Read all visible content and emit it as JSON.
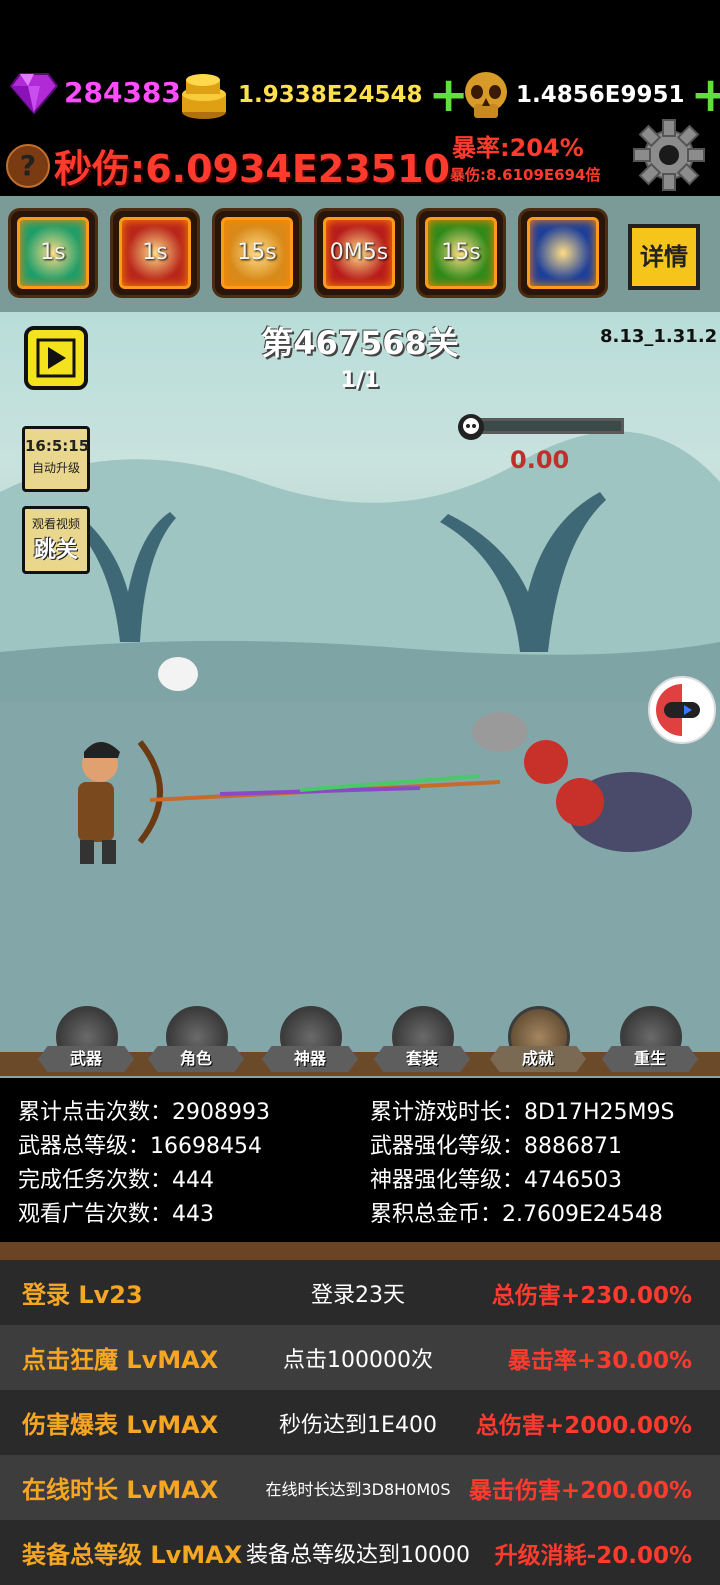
{
  "resources": {
    "gems": "284383",
    "gold": "1.9338E24548",
    "souls": "1.4856E9951",
    "gem_icon": "purple-diamond-icon",
    "gold_icon": "gold-coins-icon",
    "soul_icon": "golden-skull-icon"
  },
  "combat": {
    "dps": "秒伤:6.0934E23510",
    "crit_rate": "暴率:204%",
    "crit_damage": "暴伤:8.6109E694倍"
  },
  "skills": [
    {
      "label": "1s",
      "color": "#1f9e6a"
    },
    {
      "label": "1s",
      "color": "#b8261b"
    },
    {
      "label": "15s",
      "color": "#d88a1a"
    },
    {
      "label": "0M5s",
      "color": "#b71c1c"
    },
    {
      "label": "15s",
      "color": "#2f8a1a"
    },
    {
      "label": "",
      "color": "#1c3f9a"
    }
  ],
  "detail_button": "详情",
  "stage": {
    "title": "第467568关",
    "wave": "1/1",
    "version": "8.13_1.31.2",
    "boss_hp": "0.00"
  },
  "side_buttons": {
    "auto_time": "16:5:15",
    "auto_label": "自动升级",
    "skip_top": "观看视频",
    "skip_label": "跳关"
  },
  "nav": [
    {
      "label": "武器",
      "active": false
    },
    {
      "label": "角色",
      "active": false
    },
    {
      "label": "神器",
      "active": false
    },
    {
      "label": "套装",
      "active": false
    },
    {
      "label": "成就",
      "active": true
    },
    {
      "label": "重生",
      "active": false
    }
  ],
  "stats": [
    {
      "label": "累计点击次数：",
      "value": "2908993"
    },
    {
      "label": "累计游戏时长：",
      "value": "8D17H25M9S"
    },
    {
      "label": "武器总等级：",
      "value": "16698454"
    },
    {
      "label": "武器强化等级：",
      "value": "8886871"
    },
    {
      "label": "完成任务次数：",
      "value": "444"
    },
    {
      "label": "神器强化等级：",
      "value": "4746503"
    },
    {
      "label": "观看广告次数：",
      "value": "443"
    },
    {
      "label": "累积总金币：",
      "value": "2.7609E24548"
    }
  ],
  "achievements": [
    {
      "name": "登录 Lv23",
      "desc": "登录23天",
      "reward": "总伤害+230.00%",
      "bg": "#2a2a2a"
    },
    {
      "name": "点击狂魔 LvMAX",
      "desc": "点击100000次",
      "reward": "暴击率+30.00%",
      "bg": "#3d3d3d"
    },
    {
      "name": "伤害爆表 LvMAX",
      "desc": "秒伤达到1E400",
      "reward": "总伤害+2000.00%",
      "bg": "#2a2a2a"
    },
    {
      "name": "在线时长 LvMAX",
      "desc": "在线时长达到3D8H0M0S",
      "reward": "暴击伤害+200.00%",
      "bg": "#3d3d3d"
    },
    {
      "name": "装备总等级 LvMAX",
      "desc": "装备总等级达到10000",
      "reward": "升级消耗-20.00%",
      "bg": "#2a2a2a"
    }
  ]
}
